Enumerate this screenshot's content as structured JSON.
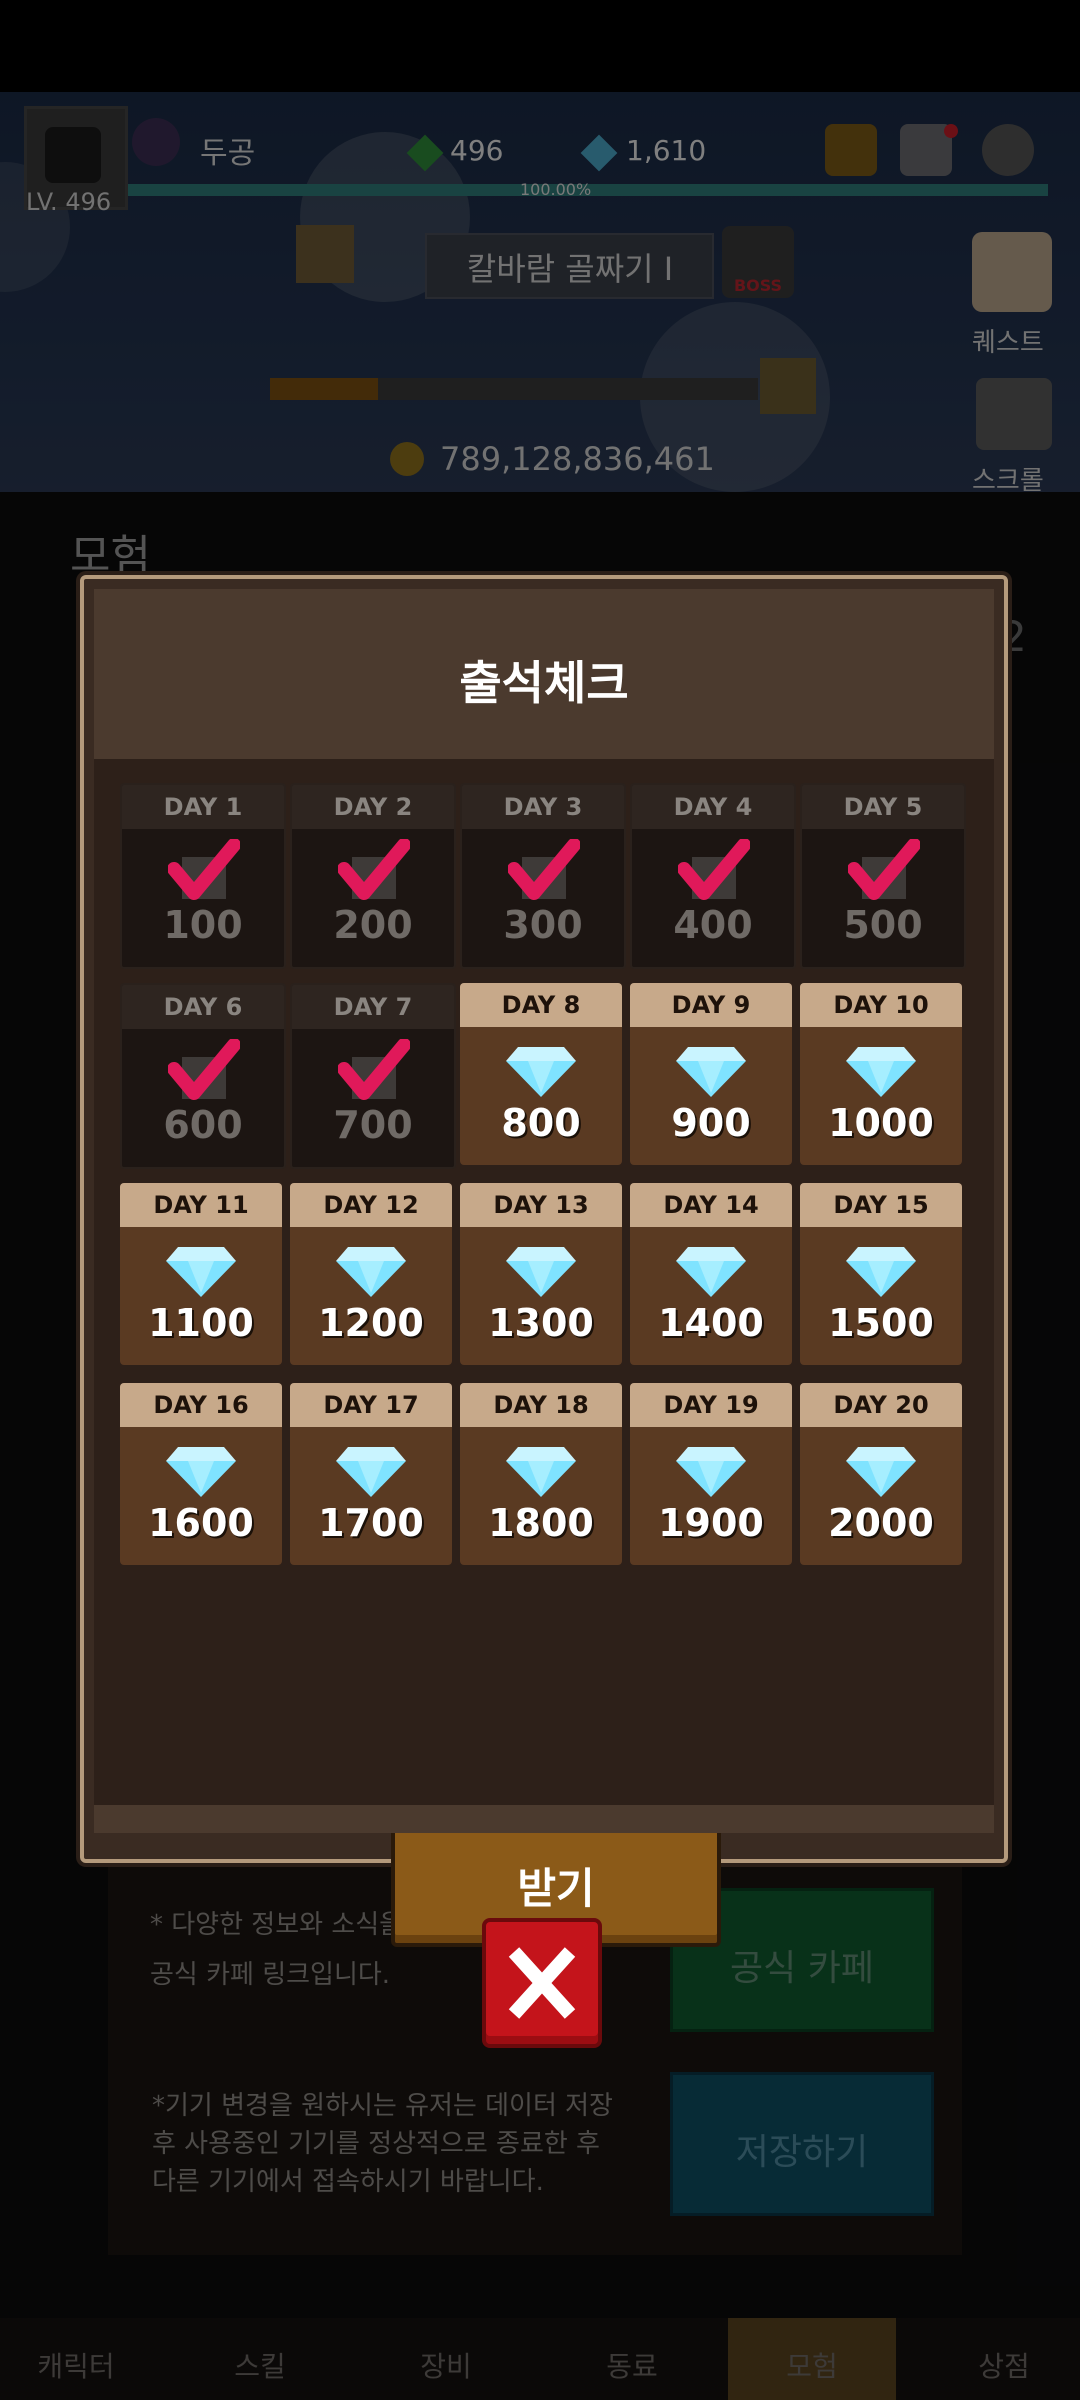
{
  "hud": {
    "level": "LV. 496",
    "player_name": "두공",
    "green_gems": "496",
    "diamonds": "1,610",
    "xp_percent": "100.00%",
    "stage_name": "칼바람 골짜기 I",
    "boss_label": "BOSS",
    "quest_label": "퀘스트",
    "scroll_label": "스크롤",
    "gold": "789,128,836,461",
    "panel_title": "모험",
    "right_edge_number": "2"
  },
  "attendance": {
    "title": "출석체크",
    "claim_label": "받기",
    "days": [
      {
        "day": "DAY 1",
        "value": "100",
        "claimed": true
      },
      {
        "day": "DAY 2",
        "value": "200",
        "claimed": true
      },
      {
        "day": "DAY 3",
        "value": "300",
        "claimed": true
      },
      {
        "day": "DAY 4",
        "value": "400",
        "claimed": true
      },
      {
        "day": "DAY 5",
        "value": "500",
        "claimed": true
      },
      {
        "day": "DAY 6",
        "value": "600",
        "claimed": true
      },
      {
        "day": "DAY 7",
        "value": "700",
        "claimed": true
      },
      {
        "day": "DAY 8",
        "value": "800",
        "claimed": false
      },
      {
        "day": "DAY 9",
        "value": "900",
        "claimed": false
      },
      {
        "day": "DAY 10",
        "value": "1000",
        "claimed": false
      },
      {
        "day": "DAY 11",
        "value": "1100",
        "claimed": false
      },
      {
        "day": "DAY 12",
        "value": "1200",
        "claimed": false
      },
      {
        "day": "DAY 13",
        "value": "1300",
        "claimed": false
      },
      {
        "day": "DAY 14",
        "value": "1400",
        "claimed": false
      },
      {
        "day": "DAY 15",
        "value": "1500",
        "claimed": false
      },
      {
        "day": "DAY 16",
        "value": "1600",
        "claimed": false
      },
      {
        "day": "DAY 17",
        "value": "1700",
        "claimed": false
      },
      {
        "day": "DAY 18",
        "value": "1800",
        "claimed": false
      },
      {
        "day": "DAY 19",
        "value": "1900",
        "claimed": false
      },
      {
        "day": "DAY 20",
        "value": "2000",
        "claimed": false
      }
    ],
    "icons": {
      "claimed": "checkmark-icon",
      "reward": "diamond-icon"
    },
    "colors": {
      "check": "#e0195a",
      "diamond": "#7fe3ff",
      "header_done": "#2e2520",
      "header_todo": "#c7a98a"
    }
  },
  "underlying": {
    "cafe_note_line1": "* 다양한 정보와 소식을 얻을",
    "cafe_note_line2": "공식 카페 링크입니다.",
    "device_note_line1": "*기기 변경을 원하시는 유저는 데이터 저장",
    "device_note_line2": "후 사용중인 기기를 정상적으로 종료한 후",
    "device_note_line3": "다른 기기에서 접속하시기 바랍니다.",
    "cafe_button": "공식 카페",
    "save_button": "저장하기"
  },
  "nav": [
    "캐릭터",
    "스킬",
    "장비",
    "동료",
    "모험",
    "상점"
  ]
}
